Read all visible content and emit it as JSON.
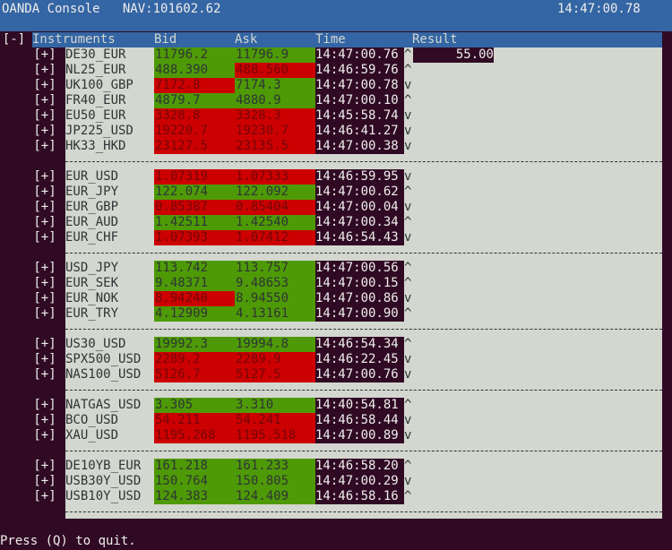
{
  "titlebar": {
    "app": "OANDA Console",
    "nav": "NAV:101602.62",
    "clock": "14:47:00.78"
  },
  "collapse_label": "[-]",
  "columns": {
    "instruments": "Instruments",
    "bid": "Bid",
    "ask": "Ask",
    "time": "Time",
    "result": "Result"
  },
  "expand_label": "[+]",
  "groups": [
    {
      "rows": [
        {
          "name": "DE30_EUR",
          "bid": "11796.2",
          "ask": "11796.9",
          "time": "14:47:00.76",
          "dir": "^",
          "bid_state": "up",
          "ask_state": "up",
          "result": "55.00"
        },
        {
          "name": "NL25_EUR",
          "bid": "488.390",
          "ask": "488.560",
          "time": "14:46:59.76",
          "dir": "^",
          "bid_state": "up",
          "ask_state": "down"
        },
        {
          "name": "UK100_GBP",
          "bid": "7172.8",
          "ask": "7174.3",
          "time": "14:47:00.78",
          "dir": "v",
          "bid_state": "down",
          "ask_state": "up"
        },
        {
          "name": "FR40_EUR",
          "bid": "4879.7",
          "ask": "4880.9",
          "time": "14:47:00.10",
          "dir": "^",
          "bid_state": "up",
          "ask_state": "up"
        },
        {
          "name": "EU50_EUR",
          "bid": "3328.8",
          "ask": "3328.3",
          "time": "14:45:58.74",
          "dir": "v",
          "bid_state": "down",
          "ask_state": "down"
        },
        {
          "name": "JP225_USD",
          "bid": "19220.7",
          "ask": "19230.7",
          "time": "14:46:41.27",
          "dir": "v",
          "bid_state": "down",
          "ask_state": "down"
        },
        {
          "name": "HK33_HKD",
          "bid": "23127.5",
          "ask": "23135.5",
          "time": "14:47:00.38",
          "dir": "v",
          "bid_state": "down",
          "ask_state": "down"
        }
      ]
    },
    {
      "rows": [
        {
          "name": "EUR_USD",
          "bid": "1.07319",
          "ask": "1.07333",
          "time": "14:46:59.95",
          "dir": "v",
          "bid_state": "down",
          "ask_state": "down"
        },
        {
          "name": "EUR_JPY",
          "bid": "122.074",
          "ask": "122.092",
          "time": "14:47:00.62",
          "dir": "^",
          "bid_state": "up",
          "ask_state": "up"
        },
        {
          "name": "EUR_GBP",
          "bid": "0.85387",
          "ask": "0.85404",
          "time": "14:47:00.04",
          "dir": "v",
          "bid_state": "down",
          "ask_state": "down"
        },
        {
          "name": "EUR_AUD",
          "bid": "1.42511",
          "ask": "1.42540",
          "time": "14:47:00.34",
          "dir": "^",
          "bid_state": "up",
          "ask_state": "up"
        },
        {
          "name": "EUR_CHF",
          "bid": "1.07393",
          "ask": "1.07412",
          "time": "14:46:54.43",
          "dir": "v",
          "bid_state": "down",
          "ask_state": "down"
        }
      ]
    },
    {
      "rows": [
        {
          "name": "USD_JPY",
          "bid": "113.742",
          "ask": "113.757",
          "time": "14:47:00.56",
          "dir": "^",
          "bid_state": "up",
          "ask_state": "up"
        },
        {
          "name": "EUR_SEK",
          "bid": "9.48371",
          "ask": "9.48653",
          "time": "14:47:00.15",
          "dir": "^",
          "bid_state": "up",
          "ask_state": "up"
        },
        {
          "name": "EUR_NOK",
          "bid": "8.94240",
          "ask": "8.94550",
          "time": "14:47:00.86",
          "dir": "v",
          "bid_state": "down",
          "ask_state": "up"
        },
        {
          "name": "EUR_TRY",
          "bid": "4.12909",
          "ask": "4.13161",
          "time": "14:47:00.90",
          "dir": "^",
          "bid_state": "up",
          "ask_state": "up"
        }
      ]
    },
    {
      "rows": [
        {
          "name": "US30_USD",
          "bid": "19992.3",
          "ask": "19994.8",
          "time": "14:46:54.34",
          "dir": "^",
          "bid_state": "up",
          "ask_state": "up"
        },
        {
          "name": "SPX500_USD",
          "bid": "2289.2",
          "ask": "2289.9",
          "time": "14:46:22.45",
          "dir": "v",
          "bid_state": "down",
          "ask_state": "down"
        },
        {
          "name": "NAS100_USD",
          "bid": "5126.7",
          "ask": "5127.5",
          "time": "14:47:00.76",
          "dir": "v",
          "bid_state": "down",
          "ask_state": "down"
        }
      ]
    },
    {
      "rows": [
        {
          "name": "NATGAS_USD",
          "bid": "3.305",
          "ask": "3.310",
          "time": "14:40:54.81",
          "dir": "^",
          "bid_state": "up",
          "ask_state": "up"
        },
        {
          "name": "BCO_USD",
          "bid": "54.211",
          "ask": "54.241",
          "time": "14:46:58.44",
          "dir": "v",
          "bid_state": "down",
          "ask_state": "down"
        },
        {
          "name": "XAU_USD",
          "bid": "1195.268",
          "ask": "1195.518",
          "time": "14:47:00.89",
          "dir": "v",
          "bid_state": "down",
          "ask_state": "down"
        }
      ]
    },
    {
      "rows": [
        {
          "name": "DE10YB_EUR",
          "bid": "161.218",
          "ask": "161.233",
          "time": "14:46:58.20",
          "dir": "^",
          "bid_state": "up",
          "ask_state": "up"
        },
        {
          "name": "USB30Y_USD",
          "bid": "150.764",
          "ask": "150.805",
          "time": "14:47:00.29",
          "dir": "v",
          "bid_state": "up",
          "ask_state": "up"
        },
        {
          "name": "USB10Y_USD",
          "bid": "124.383",
          "ask": "124.409",
          "time": "14:46:58.16",
          "dir": "^",
          "bid_state": "up",
          "ask_state": "up"
        }
      ]
    }
  ],
  "footer": "Press (Q) to quit.",
  "colors": {
    "terminal_bg": "#300a24",
    "title_bg": "#3465a4",
    "panel_bg": "#d3d7cf",
    "up": "#4e9a06",
    "down": "#cc0000"
  }
}
